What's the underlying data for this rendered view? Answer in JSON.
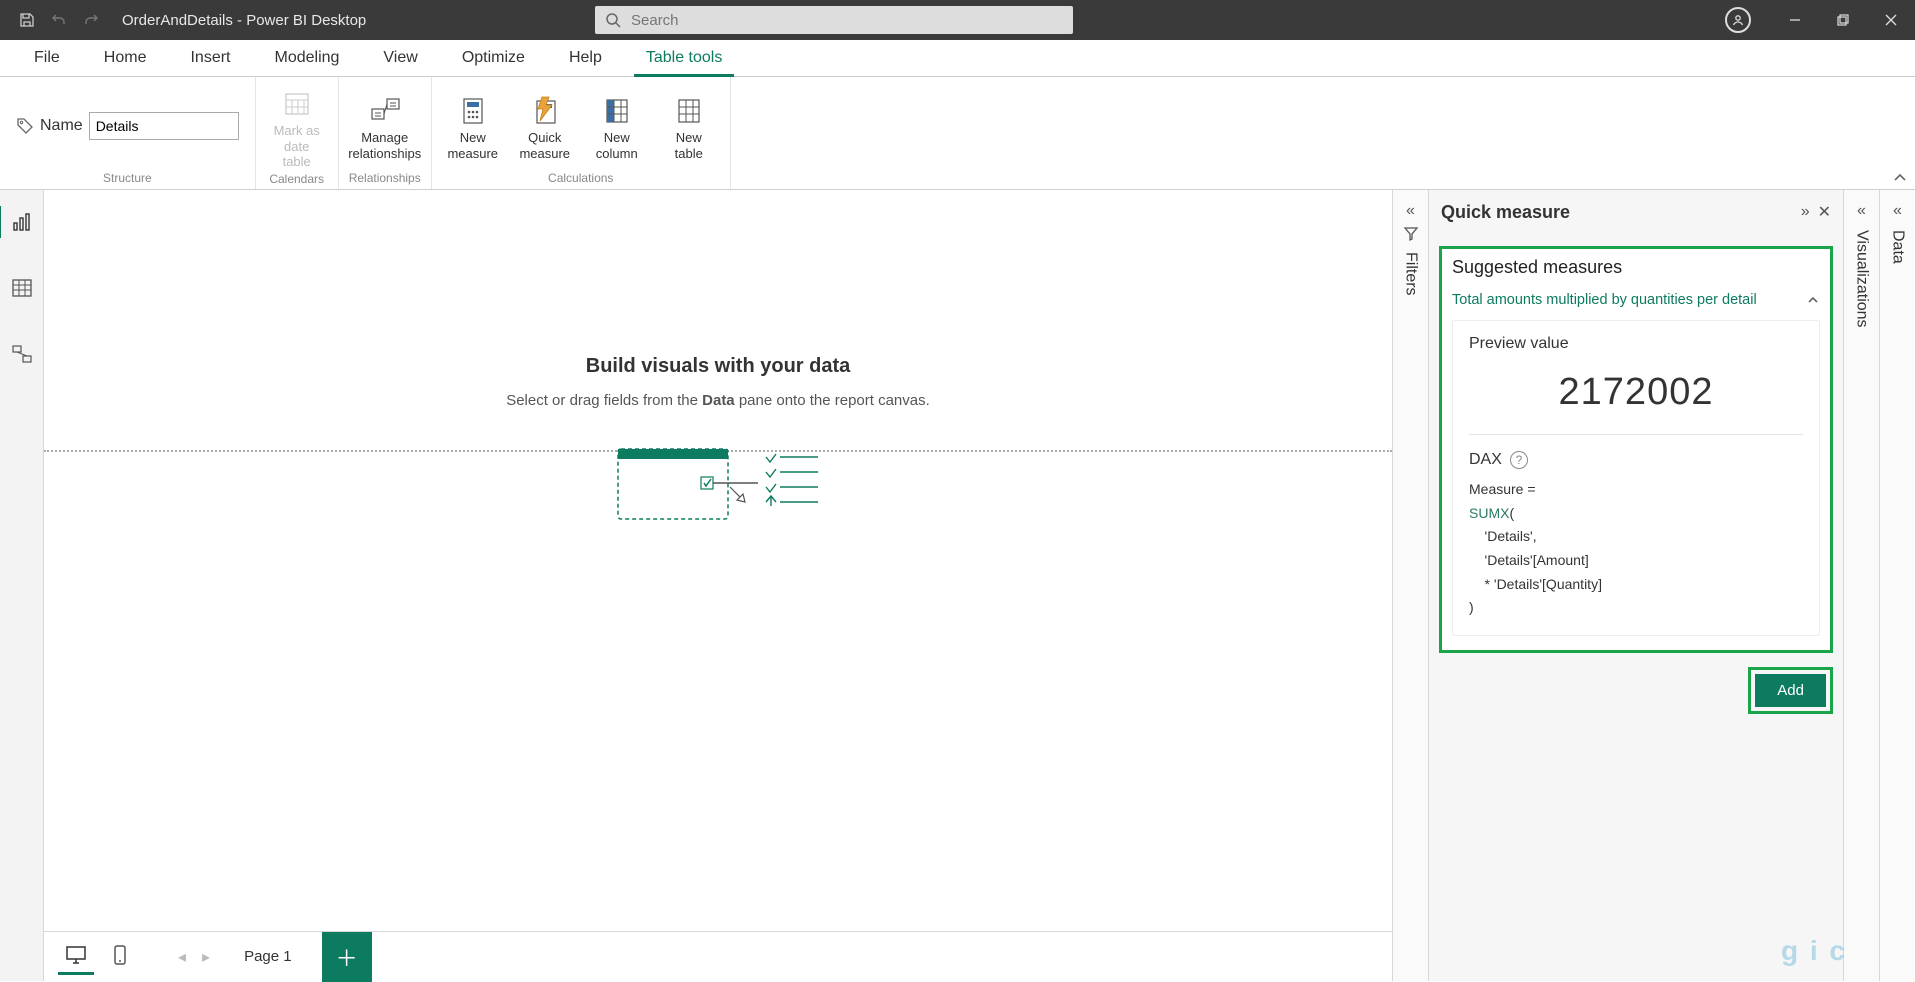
{
  "title_bar": {
    "app_title": "OrderAndDetails - Power BI Desktop",
    "search_placeholder": "Search"
  },
  "ribbon_tabs": {
    "file": "File",
    "home": "Home",
    "insert": "Insert",
    "modeling": "Modeling",
    "view": "View",
    "optimize": "Optimize",
    "help": "Help",
    "table_tools": "Table tools"
  },
  "ribbon": {
    "structure": {
      "group_label": "Structure",
      "name_label": "Name",
      "name_value": "Details"
    },
    "calendars": {
      "group_label": "Calendars",
      "mark_as_date": "Mark as date\ntable"
    },
    "relationships": {
      "group_label": "Relationships",
      "manage": "Manage\nrelationships"
    },
    "calculations": {
      "group_label": "Calculations",
      "new_measure": "New\nmeasure",
      "quick_measure": "Quick\nmeasure",
      "new_column": "New\ncolumn",
      "new_table": "New\ntable"
    }
  },
  "canvas": {
    "title": "Build visuals with your data",
    "sub_pre": "Select or drag fields from the ",
    "sub_bold": "Data",
    "sub_post": " pane onto the report canvas."
  },
  "page_strip": {
    "page_label": "Page 1"
  },
  "filters_pane": {
    "label": "Filters"
  },
  "viz_pane": {
    "label": "Visualizations"
  },
  "data_pane": {
    "label": "Data"
  },
  "quick_measure": {
    "title": "Quick measure",
    "suggested_title": "Suggested measures",
    "suggested_sub": "Total amounts multiplied by quantities per detail",
    "preview_label": "Preview value",
    "preview_value": "2172002",
    "dax_label": "DAX",
    "dax_line1": "Measure =",
    "dax_kw": "SUMX",
    "dax_paren_open": "(",
    "dax_line3": "    'Details',",
    "dax_line4": "    'Details'[Amount]",
    "dax_line5": "    * 'Details'[Quantity]",
    "dax_line6": ")",
    "add_label": "Add"
  },
  "watermark": "g i c"
}
